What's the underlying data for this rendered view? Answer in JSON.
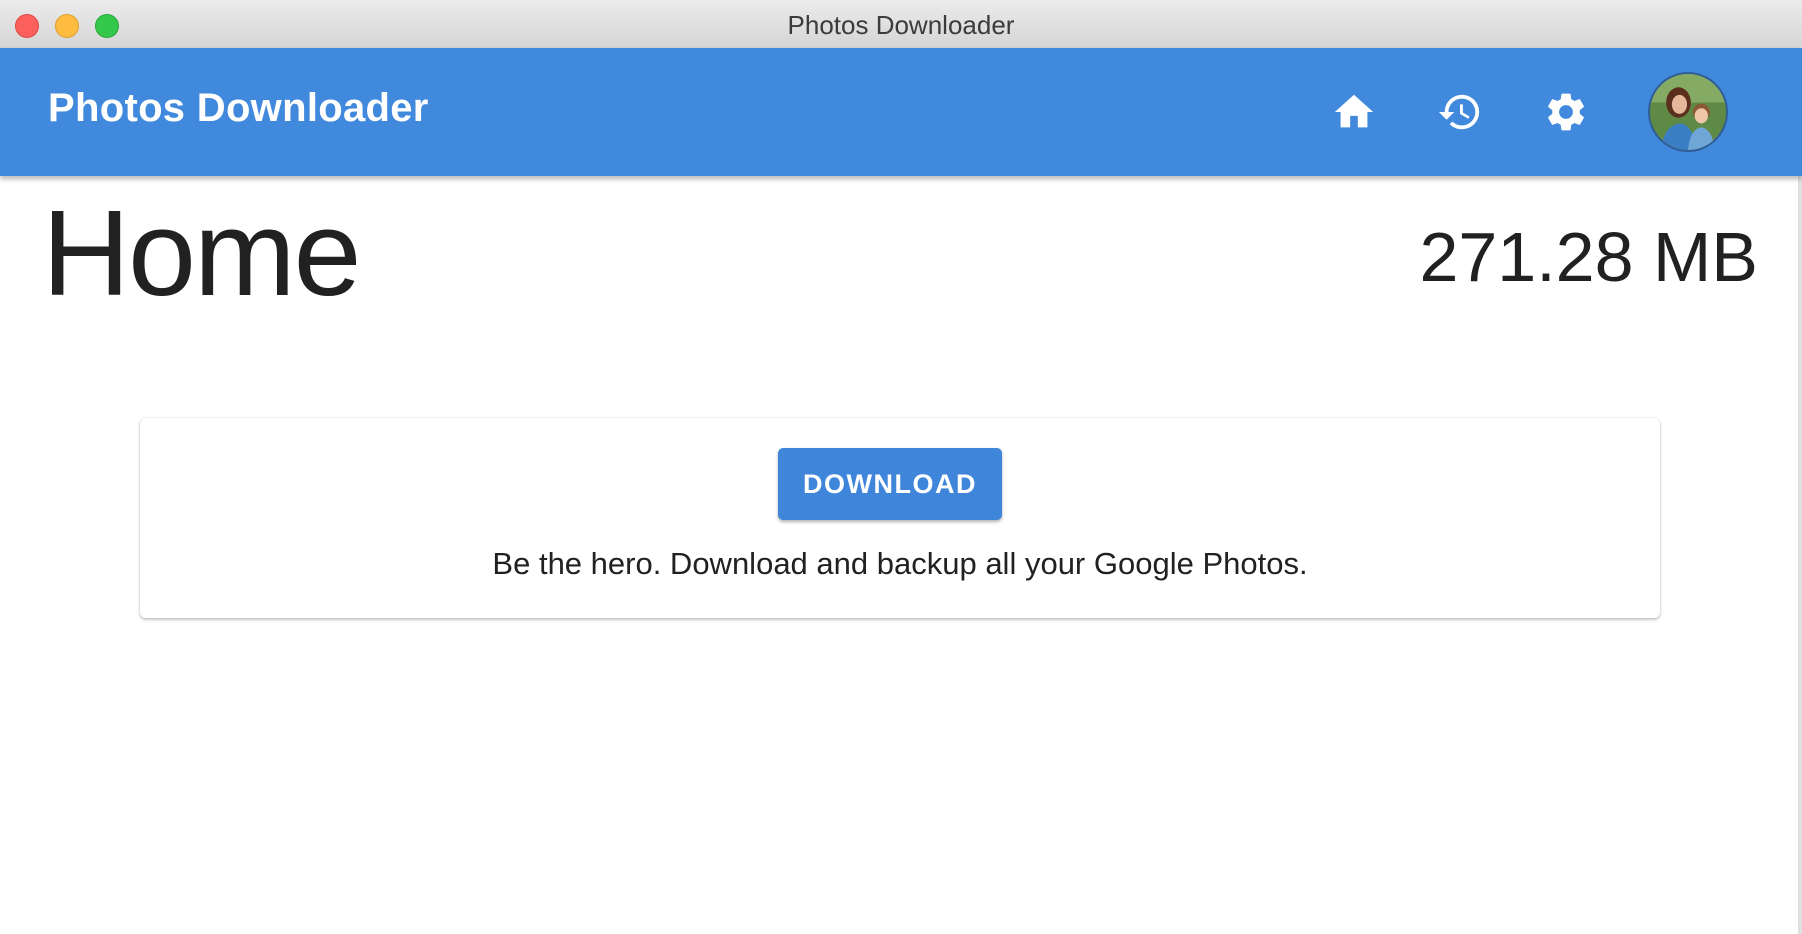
{
  "window": {
    "title": "Photos Downloader"
  },
  "appbar": {
    "title": "Photos Downloader",
    "background_color": "#4189dd",
    "nav": [
      {
        "name": "home",
        "icon": "home-icon"
      },
      {
        "name": "history",
        "icon": "history-icon"
      },
      {
        "name": "settings",
        "icon": "gear-icon"
      }
    ],
    "avatar_icon": "user-avatar"
  },
  "main": {
    "page_title": "Home",
    "storage_size": "271.28 MB",
    "card": {
      "download_label": "DOWNLOAD",
      "tagline": "Be the hero. Download and backup all your Google Photos."
    }
  },
  "colors": {
    "accent": "#3f86db",
    "text": "#212121"
  }
}
